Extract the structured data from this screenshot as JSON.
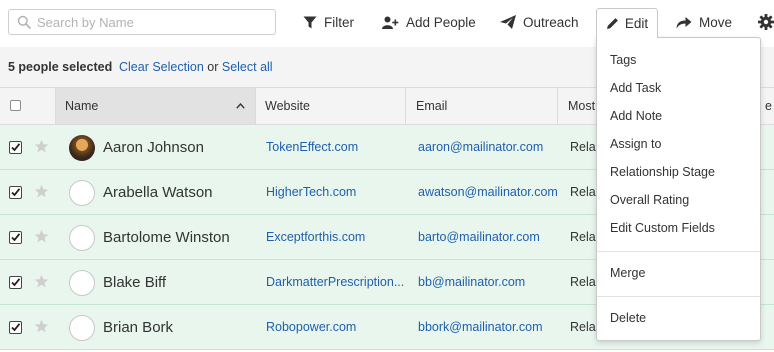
{
  "search": {
    "placeholder": "Search by Name",
    "value": ""
  },
  "toolbar": {
    "filter_label": "Filter",
    "add_people_label": "Add People",
    "outreach_label": "Outreach",
    "edit_label": "Edit",
    "move_label": "Move"
  },
  "selection": {
    "count_text": "5 people selected",
    "clear_label": "Clear Selection",
    "or_text": "or",
    "select_all_label": "Select all"
  },
  "table": {
    "columns": {
      "name": "Name",
      "website": "Website",
      "email": "Email",
      "most": "Most",
      "overflow": "e"
    },
    "rows": [
      {
        "name": "Aaron Johnson",
        "website": "TokenEffect.com",
        "email": "aaron@mailinator.com",
        "most": "Rela",
        "avatar": "photo"
      },
      {
        "name": "Arabella Watson",
        "website": "HigherTech.com",
        "email": "awatson@mailinator.com",
        "most": "Rela",
        "avatar": "blank"
      },
      {
        "name": "Bartolome Winston",
        "website": "Exceptforthis.com",
        "email": "barto@mailinator.com",
        "most": "Rela",
        "avatar": "blank"
      },
      {
        "name": "Blake Biff",
        "website": "DarkmatterPrescription...",
        "email": "bb@mailinator.com",
        "most": "Rela",
        "avatar": "blank"
      },
      {
        "name": "Brian Bork",
        "website": "Robopower.com",
        "email": "bbork@mailinator.com",
        "most": "Rela",
        "avatar": "blank"
      }
    ]
  },
  "edit_menu": {
    "items": [
      "Tags",
      "Add Task",
      "Add Note",
      "Assign to",
      "Relationship Stage",
      "Overall Rating",
      "Edit Custom Fields",
      "Merge",
      "Delete"
    ]
  },
  "colors": {
    "link": "#1f5fad",
    "row_selected": "#e8f6ee",
    "header_bg": "#f4f4f4"
  }
}
